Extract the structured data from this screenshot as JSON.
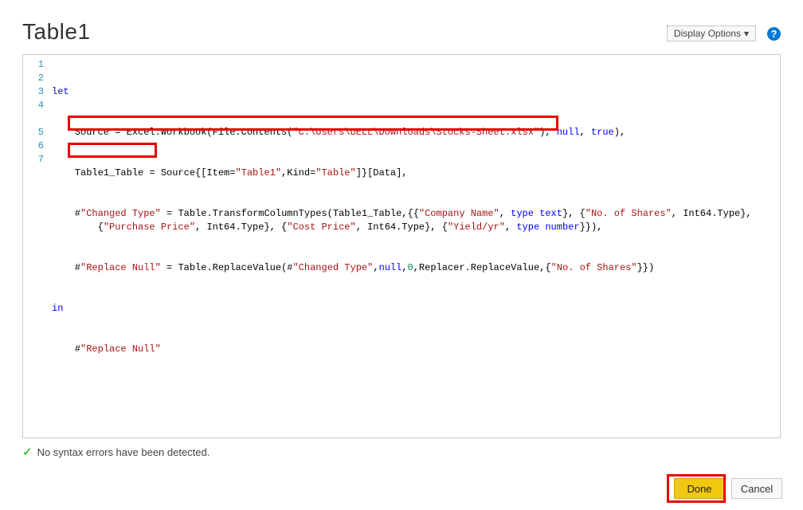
{
  "header": {
    "title": "Table1",
    "display_options_label": "Display Options",
    "help_glyph": "?"
  },
  "code": {
    "lines": [
      {
        "n": 1
      },
      {
        "n": 2
      },
      {
        "n": 3
      },
      {
        "n": 4
      },
      {
        "n": 5
      },
      {
        "n": 6
      },
      {
        "n": 7
      }
    ],
    "tokens": {
      "let": "let",
      "in": "in",
      "null": "null",
      "true": "true",
      "source_prefix": "    Source = Excel.Workbook(File.Contents(",
      "file_path": "\"C:\\Users\\DELL\\Downloads\\Stocks-Sheet.xlsx\"",
      "source_suffix": "),",
      "table1_prefix": "    Table1_Table = Source{[Item=",
      "table1_item": "\"Table1\"",
      "kind_eq": ",Kind=",
      "kind_val": "\"Table\"",
      "table1_suffix": "]}[Data],",
      "changed_prefix_a": "    #",
      "changed_step": "\"Changed Type\"",
      "changed_eq": " = Table.TransformColumnTypes(Table1_Table,{{",
      "col_company": "\"Company Name\"",
      "type_text": "type text",
      "col_shares": "\"No. of Shares\"",
      "int64": "Int64.Type",
      "wrap_open": "        {",
      "col_purchase": "\"Purchase Price\"",
      "col_cost": "\"Cost Price\"",
      "col_yield": "\"Yield/yr\"",
      "type_number": "type number",
      "replace_prefix": "    #",
      "replace_step": "\"Replace Null\"",
      "replace_eq": " = Table.ReplaceValue(#",
      "zero": "0",
      "replace_mid": ",Replacer.ReplaceValue,{",
      "replace_last": "    #",
      "sep_comma_sp": ", ",
      "sep_comma": ",",
      "rbr_comma_sp_lbr": "}, {",
      "brace_close2": "}})",
      "brace_close2_comma": "}}),",
      "paren_close_comma": "),"
    }
  },
  "status": {
    "check_glyph": "✓",
    "message": "No syntax errors have been detected."
  },
  "footer": {
    "done_label": "Done",
    "cancel_label": "Cancel"
  }
}
